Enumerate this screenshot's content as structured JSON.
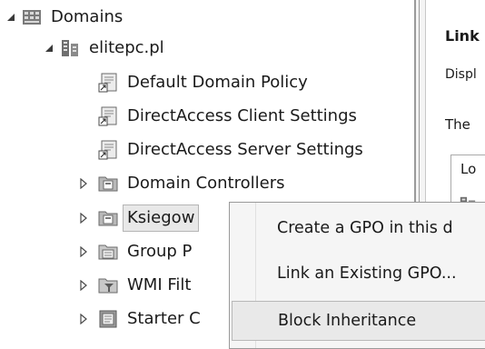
{
  "tree": {
    "items": [
      {
        "label": "Domains",
        "expanded": true,
        "icon": "domains-icon"
      },
      {
        "label": "elitepc.pl",
        "expanded": true,
        "icon": "domain-icon"
      },
      {
        "label": "Default Domain Policy",
        "icon": "gpo-link-icon"
      },
      {
        "label": "DirectAccess Client Settings",
        "icon": "gpo-link-icon"
      },
      {
        "label": "DirectAccess Server Settings",
        "icon": "gpo-link-icon"
      },
      {
        "label": "Domain Controllers",
        "expanded": false,
        "icon": "ou-icon"
      },
      {
        "label": "Ksiegow",
        "expanded": false,
        "icon": "ou-icon",
        "selected": true
      },
      {
        "label": "Group P",
        "expanded": false,
        "icon": "gpo-folder-icon"
      },
      {
        "label": "WMI Filt",
        "expanded": false,
        "icon": "wmi-filter-icon"
      },
      {
        "label": "Starter C",
        "expanded": false,
        "icon": "starter-gpo-icon"
      }
    ]
  },
  "right_pane": {
    "title": "Link",
    "desc": "Displ",
    "text": "The",
    "column_header": "Lo"
  },
  "context_menu": {
    "items": [
      {
        "label": "Create a GPO in this d",
        "highlighted": false
      },
      {
        "label": "Link an Existing GPO...",
        "highlighted": false
      },
      {
        "label": "Block Inheritance",
        "highlighted": true
      }
    ]
  },
  "colors": {
    "menu_bg": "#f5f5f5",
    "highlight": "#e9e9e9",
    "selection": "#e8e8e8"
  }
}
